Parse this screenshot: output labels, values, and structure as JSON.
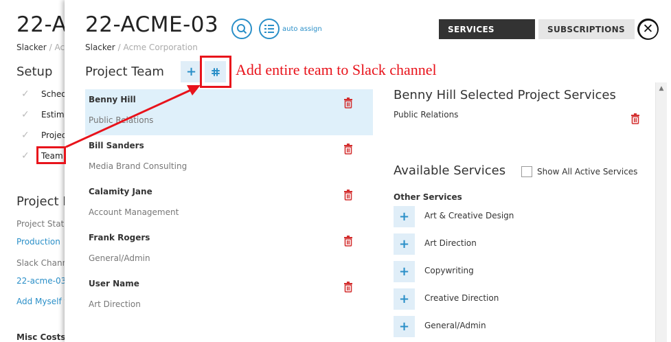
{
  "background": {
    "title": "22-A",
    "breadcrumb_org": "Slacker",
    "breadcrumb_sep": "/",
    "breadcrumb_client": "Acr",
    "setup_heading": "Setup",
    "steps": [
      {
        "label": "Sched"
      },
      {
        "label": "Estima"
      },
      {
        "label": "Projec"
      },
      {
        "label": "Team"
      }
    ],
    "project_heading": "Project I",
    "project_status_label": "Project Status",
    "project_status_value": "Production",
    "slack_channel_label": "Slack Channel",
    "slack_channel_value": "22-acme-03",
    "add_myself": "Add Myself t",
    "misc_costs": "Misc Costs"
  },
  "panel": {
    "title": "22-ACME-03",
    "breadcrumb_org": "Slacker",
    "breadcrumb_sep": "/",
    "breadcrumb_client": "Acme Corporation",
    "auto_assign": "auto assign",
    "tabs": {
      "services": "SERVICES",
      "subscriptions": "SUBSCRIPTIONS"
    },
    "close_symbol": "✕",
    "project_team_heading": "Project Team",
    "add_member_symbol": "+",
    "team": [
      {
        "name": "Benny Hill",
        "role": "Public Relations",
        "selected": true
      },
      {
        "name": "Bill Sanders",
        "role": "Media Brand Consulting",
        "selected": false
      },
      {
        "name": "Calamity Jane",
        "role": "Account Management",
        "selected": false
      },
      {
        "name": "Frank Rogers",
        "role": "General/Admin",
        "selected": false
      },
      {
        "name": "User Name",
        "role": "Art Direction",
        "selected": false
      }
    ],
    "selected_services_heading": "Benny Hill Selected Project Services",
    "selected_services": [
      "Public Relations"
    ],
    "available_heading": "Available Services",
    "show_all_label": "Show All Active Services",
    "show_all_checked": false,
    "other_services_heading": "Other Services",
    "available_services": [
      "Art & Creative Design",
      "Art Direction",
      "Copywriting",
      "Creative Direction",
      "General/Admin"
    ]
  },
  "annotation": {
    "text": "Add entire team to Slack channel",
    "color": "#e8131b"
  },
  "colors": {
    "accent": "#2a8fc8",
    "selected_row": "#dff0fa",
    "delete": "#d32f2f",
    "tab_active": "#333333",
    "tab_inactive": "#e6e6e6"
  },
  "icons": {
    "search_member": "search-icon",
    "auto_assign": "list-icon",
    "add_member": "plus-icon",
    "slack": "slack-icon",
    "delete": "trash-icon",
    "check": "checkmark-icon",
    "close": "close-icon"
  }
}
